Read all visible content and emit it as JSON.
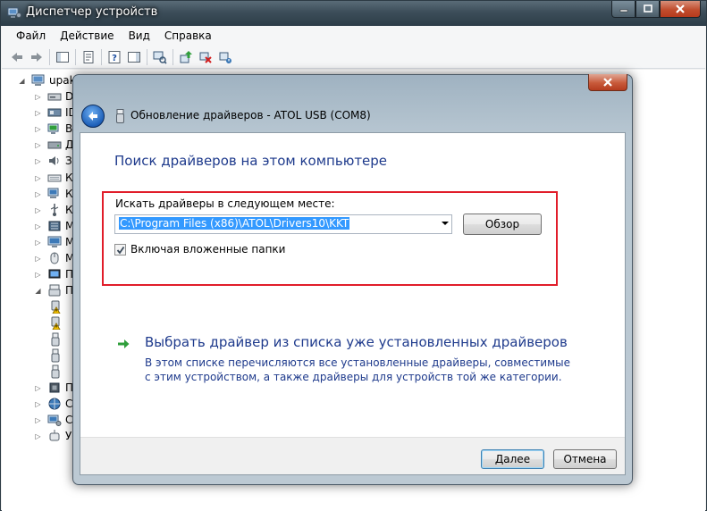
{
  "window": {
    "title": "Диспетчер устройств"
  },
  "menu": [
    "Файл",
    "Действие",
    "Вид",
    "Справка"
  ],
  "tree": {
    "root": "upako",
    "items": [
      {
        "label": "DV",
        "icon": "dvd-drive-icon"
      },
      {
        "label": "ID",
        "icon": "ide-controller-icon"
      },
      {
        "label": "Ви",
        "icon": "display-adapter-icon"
      },
      {
        "label": "Ди",
        "icon": "disk-drive-icon"
      },
      {
        "label": "Зв",
        "icon": "sound-icon"
      },
      {
        "label": "Кл",
        "icon": "keyboard-icon"
      },
      {
        "label": "Ко",
        "icon": "computer-icon"
      },
      {
        "label": "Ко",
        "icon": "usb-controller-icon"
      },
      {
        "label": "М",
        "icon": "memory-device-icon"
      },
      {
        "label": "М",
        "icon": "monitor-icon"
      },
      {
        "label": "М",
        "icon": "mouse-icon"
      },
      {
        "label": "П",
        "icon": "portable-device-icon"
      },
      {
        "label": "П",
        "icon": "ports-icon"
      },
      {
        "label": "",
        "icon": "warning-port-icon"
      },
      {
        "label": "",
        "icon": "warning-port-icon"
      },
      {
        "label": "",
        "icon": "port-icon"
      },
      {
        "label": "",
        "icon": "port-icon"
      },
      {
        "label": "",
        "icon": "port-icon"
      },
      {
        "label": "Пр",
        "icon": "processor-icon"
      },
      {
        "label": "Се",
        "icon": "network-adapter-icon"
      },
      {
        "label": "Си",
        "icon": "system-device-icon"
      },
      {
        "label": "Ус",
        "icon": "hid-device-icon"
      }
    ]
  },
  "dialog": {
    "header_title": "Обновление драйверов - ATOL USB (COM8)",
    "heading": "Поиск драйверов на этом компьютере",
    "path_label": "Искать драйверы в следующем месте:",
    "path_value": "C:\\Program Files (x86)\\ATOL\\Drivers10\\KKT",
    "browse_label": "Обзор",
    "include_subfolders_label": "Включая вложенные папки",
    "include_subfolders_checked": true,
    "choose_link": "Выбрать драйвер из списка уже установленных драйверов",
    "choose_description": "В этом списке перечисляются все установленные драйверы, совместимые с этим устройством, а также драйверы для устройств той же категории.",
    "next_label": "Далее",
    "cancel_label": "Отмена"
  },
  "colors": {
    "link_blue": "#1e3a8c",
    "highlight_red": "#e11d2a",
    "selection_blue": "#3399ff"
  }
}
